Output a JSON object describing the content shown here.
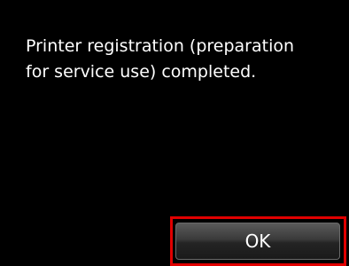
{
  "dialog": {
    "message": "Printer registration (preparation\nfor service use) completed.",
    "ok_label": "OK"
  },
  "colors": {
    "background": "#000000",
    "text": "#ffffff",
    "highlight": "#e00000"
  }
}
